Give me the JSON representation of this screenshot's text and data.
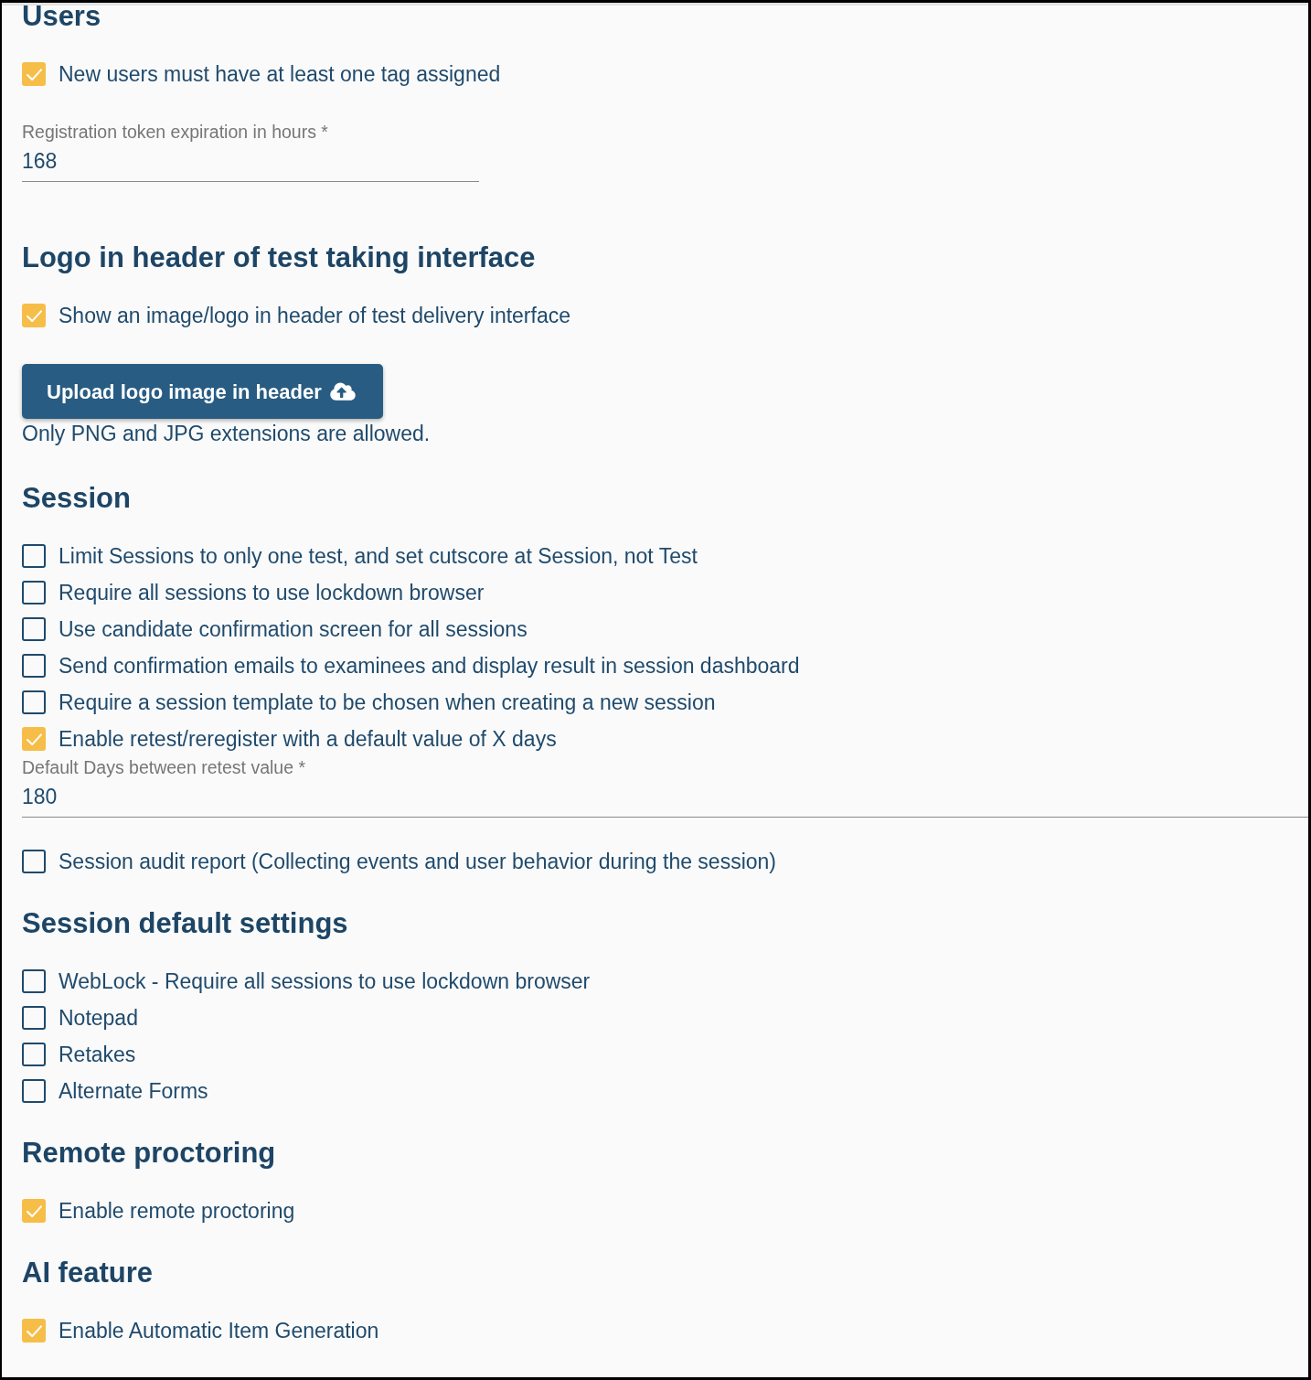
{
  "sections": [
    {
      "title": "Users",
      "items": [
        {
          "kind": "checkbox",
          "label": "New users must have at least one tag assigned",
          "checked": true
        },
        {
          "kind": "field",
          "label": "Registration token expiration in hours *",
          "value": "168"
        }
      ]
    },
    {
      "title": "Logo in header of test taking interface",
      "items": [
        {
          "kind": "checkbox",
          "label": "Show an image/logo in header of test delivery interface",
          "checked": true
        },
        {
          "kind": "button",
          "label": "Upload logo image in header"
        },
        {
          "kind": "note",
          "text": "Only PNG and JPG extensions are allowed."
        }
      ]
    },
    {
      "title": "Session",
      "items": [
        {
          "kind": "checkbox",
          "label": "Limit Sessions to only one test, and set cutscore at Session, not Test",
          "checked": false
        },
        {
          "kind": "checkbox",
          "label": "Require all sessions to use lockdown browser",
          "checked": false
        },
        {
          "kind": "checkbox",
          "label": "Use candidate confirmation screen for all sessions",
          "checked": false
        },
        {
          "kind": "checkbox",
          "label": "Send confirmation emails to examinees and display result in session dashboard",
          "checked": false
        },
        {
          "kind": "checkbox",
          "label": "Require a session template to be chosen when creating a new session",
          "checked": false
        },
        {
          "kind": "checkbox",
          "label": "Enable retest/reregister with a default value of X days",
          "checked": true,
          "field": {
            "label": "Default Days between retest value *",
            "value": "180"
          }
        },
        {
          "kind": "checkbox",
          "label": "Session audit report (Collecting events and user behavior during the session)",
          "checked": false
        }
      ]
    },
    {
      "title": "Session default settings",
      "items": [
        {
          "kind": "checkbox",
          "label": "WebLock - Require all sessions to use lockdown browser",
          "checked": false
        },
        {
          "kind": "checkbox",
          "label": "Notepad",
          "checked": false
        },
        {
          "kind": "checkbox",
          "label": "Retakes",
          "checked": false
        },
        {
          "kind": "checkbox",
          "label": "Alternate Forms",
          "checked": false
        }
      ]
    },
    {
      "title": "Remote proctoring",
      "items": [
        {
          "kind": "checkbox",
          "label": "Enable remote proctoring",
          "checked": true
        }
      ]
    },
    {
      "title": "AI feature",
      "items": [
        {
          "kind": "checkbox",
          "label": "Enable Automatic Item Generation",
          "checked": true
        }
      ]
    }
  ]
}
